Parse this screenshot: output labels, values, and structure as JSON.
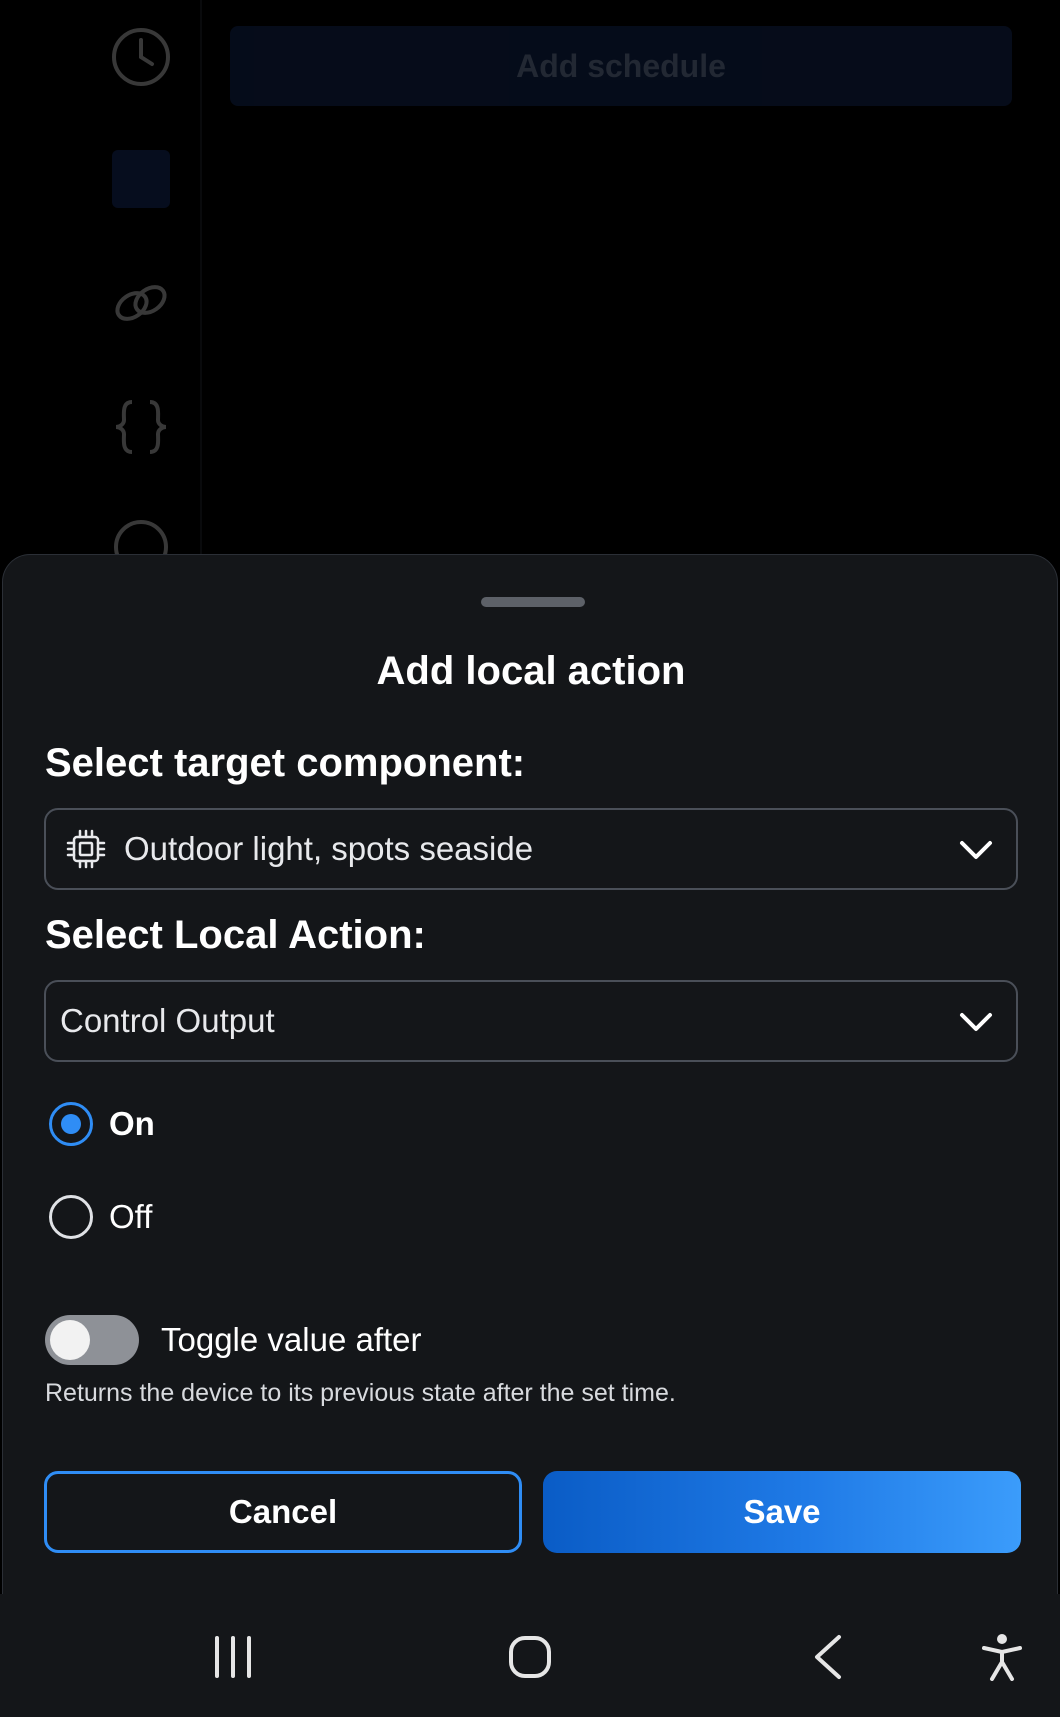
{
  "background": {
    "add_schedule_label": "Add schedule",
    "rail_icons": [
      "clock-icon",
      "square-icon",
      "link-icon",
      "braces-icon",
      "circle-icon"
    ]
  },
  "sheet": {
    "title": "Add local action",
    "target_label": "Select target component:",
    "target_select": {
      "icon": "chip-icon",
      "value": "Outdoor light, spots seaside"
    },
    "action_label": "Select Local Action:",
    "action_select": {
      "value": "Control Output"
    },
    "radio_options": [
      {
        "label": "On",
        "checked": true
      },
      {
        "label": "Off",
        "checked": false
      }
    ],
    "toggle": {
      "label": "Toggle value after",
      "on": false,
      "helper": "Returns the device to its previous state after the set time."
    },
    "buttons": {
      "cancel": "Cancel",
      "save": "Save"
    }
  },
  "colors": {
    "accent": "#2f8df5",
    "sheet_bg": "#141619",
    "border": "#4a4f58"
  },
  "nav_bar": {
    "icons": [
      "recent-apps-icon",
      "home-icon",
      "back-icon",
      "accessibility-icon"
    ]
  }
}
